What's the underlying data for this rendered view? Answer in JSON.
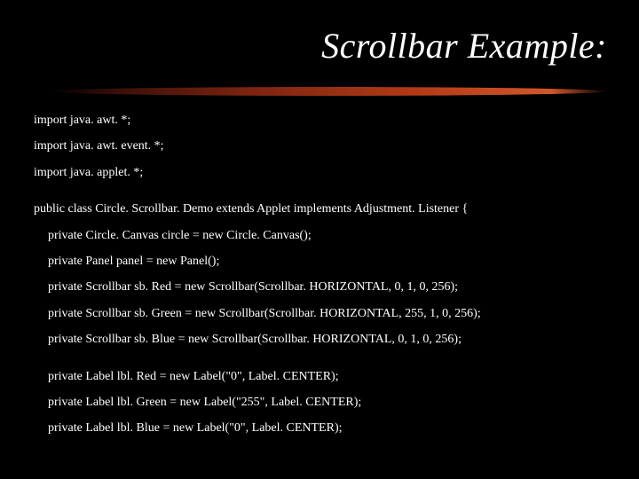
{
  "title": "Scrollbar Example:",
  "code": {
    "l0": "import java. awt. *;",
    "l1": "import java. awt. event. *;",
    "l2": "import java. applet. *;",
    "l3": "public class Circle. Scrollbar. Demo extends Applet implements Adjustment. Listener {",
    "l4": "private Circle. Canvas circle = new Circle. Canvas();",
    "l5": "private Panel panel = new Panel();",
    "l6": "private Scrollbar sb. Red = new Scrollbar(Scrollbar. HORIZONTAL, 0, 1, 0, 256);",
    "l7": "private Scrollbar sb. Green = new Scrollbar(Scrollbar. HORIZONTAL, 255, 1, 0, 256);",
    "l8": "private Scrollbar sb. Blue = new Scrollbar(Scrollbar. HORIZONTAL, 0, 1, 0, 256);",
    "l9": "private Label lbl. Red = new Label(\"0\", Label. CENTER);",
    "l10": "private Label lbl. Green = new Label(\"255\", Label. CENTER);",
    "l11": "private Label lbl. Blue = new Label(\"0\", Label. CENTER);"
  }
}
